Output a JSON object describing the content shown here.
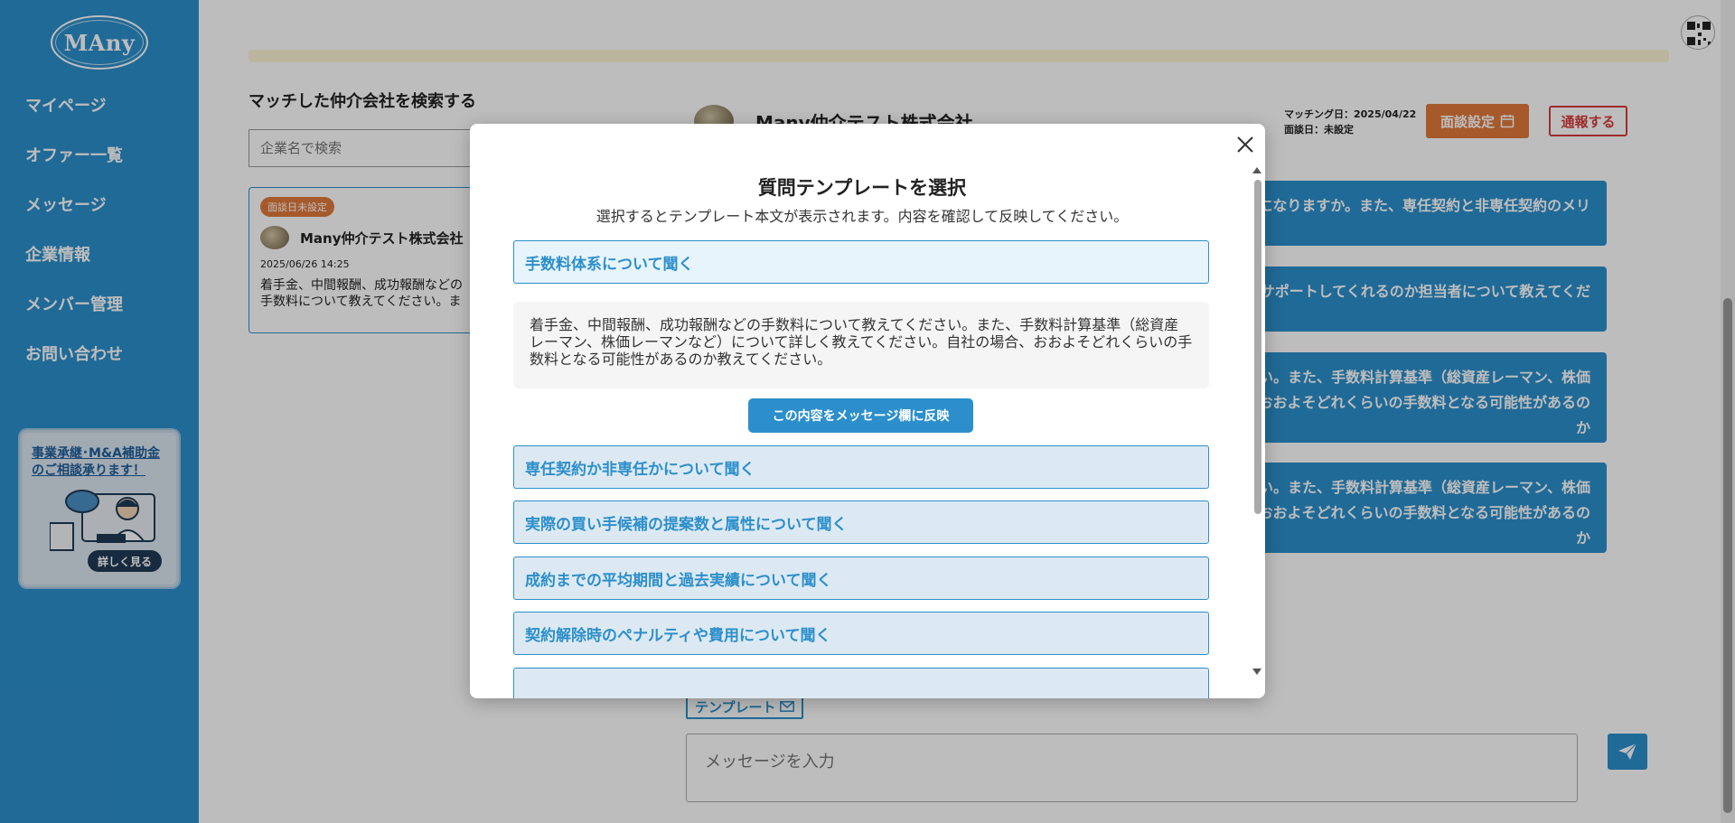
{
  "sidebar": {
    "logo": "MAny",
    "nav": [
      "マイページ",
      "オファー一覧",
      "メッセージ",
      "企業情報",
      "メンバー管理",
      "お問い合わせ"
    ],
    "promo": {
      "text": "事業承継･M&A補助金のご相談承ります！",
      "button": "詳しく見る"
    }
  },
  "search": {
    "title": "マッチした仲介会社を検索する",
    "placeholder": "企業名で検索"
  },
  "match_card": {
    "badge": "面談日未設定",
    "company": "Many仲介テスト株式会社",
    "date": "2025/06/26 14:25",
    "preview": "着手金、中間報酬、成功報酬などの手数料について教えてください。また、手数料計算基準（総"
  },
  "chat": {
    "company": "Many仲介テスト株式会社",
    "matching_date": "マッチング日：2025/04/22",
    "interview_date": "面談日：未設定",
    "interview_button": "面談設定",
    "report_button": "通報する",
    "messages": [
      "になりますか。また、専任契約と非専任契約のメリ",
      "がサポートしてくれるのか担当者について教えてくだ",
      "い。また、手数料計算基準（総資産レーマン、株価\nおおよそどれくらいの手数料となる可能性があるのか",
      "い。また、手数料計算基準（総資産レーマン、株価\nおおよそどれくらいの手数料となる可能性があるのか"
    ],
    "template_link": "テンプレート",
    "input_placeholder": "メッセージを入力"
  },
  "modal": {
    "title": "質問テンプレートを選択",
    "subtitle": "選択するとテンプレート本文が表示されます。内容を確認して反映してください。",
    "templates": [
      "手数料体系について聞く",
      "専任契約か非専任かについて聞く",
      "実際の買い手候補の提案数と属性について聞く",
      "成約までの平均期間と過去実績について聞く",
      "契約解除時のペナルティや費用について聞く"
    ],
    "selected_body": "着手金、中間報酬、成功報酬などの手数料について教えてください。また、手数料計算基準（総資産レーマン、株価レーマンなど）について詳しく教えてください。自社の場合、おおよそどれくらいの手数料となる可能性があるのか教えてください。",
    "apply_button": "この内容をメッセージ欄に反映"
  },
  "colors": {
    "brand": "#2c8fcc",
    "accent_orange": "#e07a3c",
    "danger": "#d73a3a"
  }
}
